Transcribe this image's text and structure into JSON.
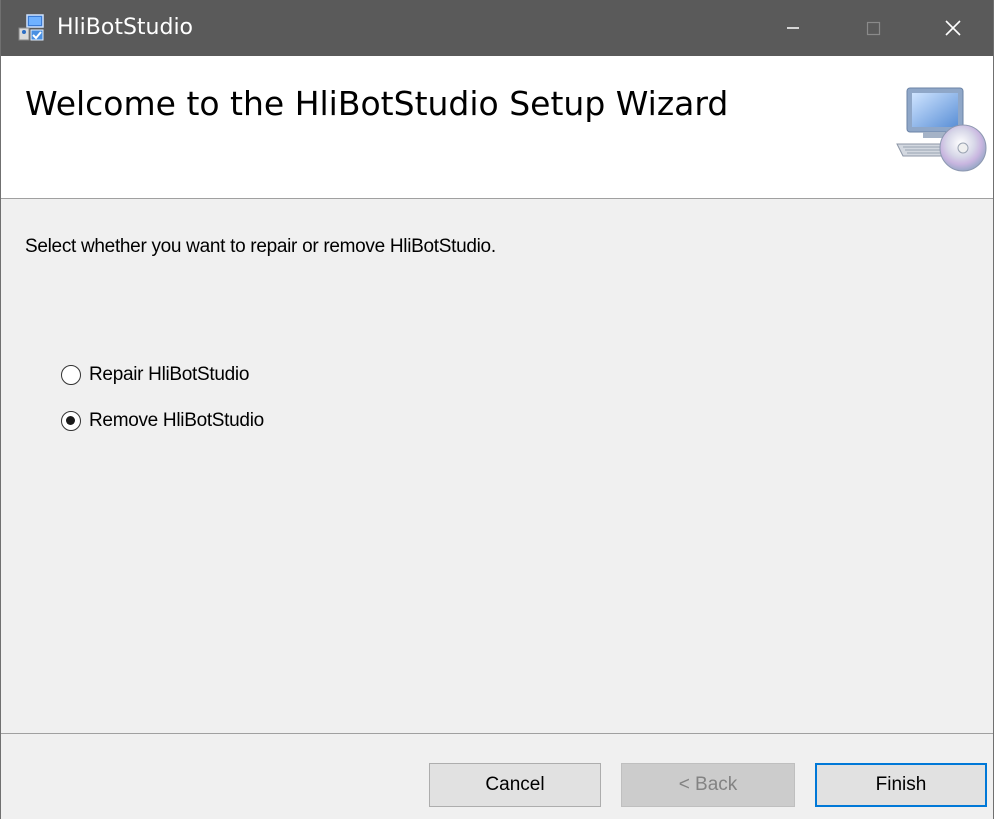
{
  "window": {
    "title": "HliBotStudio",
    "icon": "installer-icon",
    "controls": {
      "minimize": "minimize-icon",
      "maximize": "maximize-icon",
      "close": "close-icon"
    }
  },
  "banner": {
    "title": "Welcome to the HliBotStudio Setup Wizard",
    "graphic": "computer-cd-icon"
  },
  "body": {
    "instruction": "Select whether you want to repair or remove HliBotStudio.",
    "options": [
      {
        "label": "Repair HliBotStudio",
        "selected": false
      },
      {
        "label": "Remove HliBotStudio",
        "selected": true
      }
    ]
  },
  "footer": {
    "cancel_label": "Cancel",
    "back_label": "< Back",
    "finish_label": "Finish",
    "back_enabled": false
  },
  "colors": {
    "titlebar": "#5a5a5a",
    "accent": "#0078d7",
    "dialog_bg": "#f0f0f0"
  }
}
